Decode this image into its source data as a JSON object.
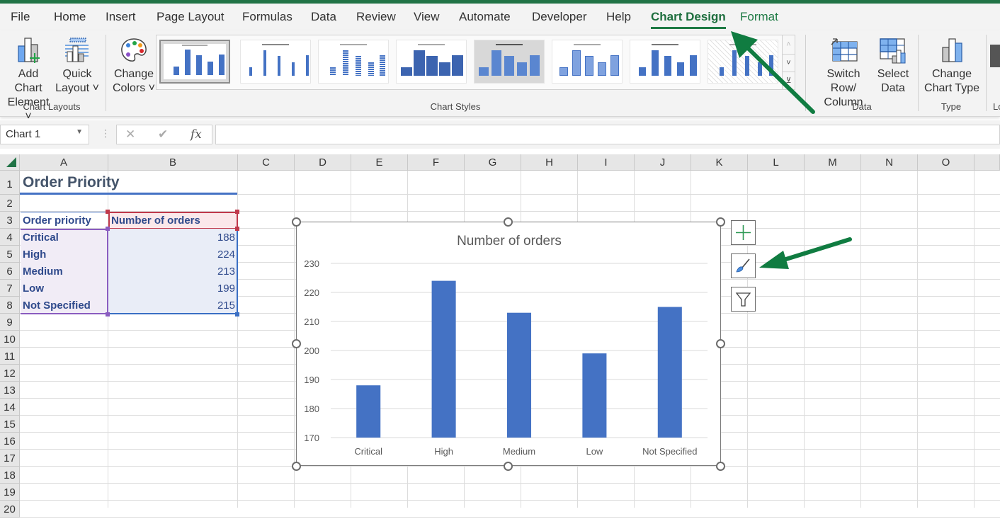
{
  "ribbon_tabs": [
    {
      "label": "File"
    },
    {
      "label": "Home"
    },
    {
      "label": "Insert"
    },
    {
      "label": "Page Layout"
    },
    {
      "label": "Formulas"
    },
    {
      "label": "Data"
    },
    {
      "label": "Review"
    },
    {
      "label": "View"
    },
    {
      "label": "Automate"
    },
    {
      "label": "Developer"
    },
    {
      "label": "Help"
    },
    {
      "label": "Chart Design",
      "active": true
    },
    {
      "label": "Format"
    }
  ],
  "ribbon": {
    "add_chart_element": {
      "line1": "Add Chart",
      "line2": "Element ˅"
    },
    "quick_layout": {
      "line1": "Quick",
      "line2": "Layout ˅"
    },
    "change_colors": {
      "line1": "Change",
      "line2": "Colors ˅"
    },
    "switch_row_column": {
      "line1": "Switch Row/",
      "line2": "Column"
    },
    "select_data": {
      "line1": "Select",
      "line2": "Data"
    },
    "change_chart_type": {
      "line1": "Change",
      "line2": "Chart Type"
    },
    "groups": {
      "chart_layouts": "Chart Layouts",
      "chart_styles": "Chart Styles",
      "data": "Data",
      "type": "Type",
      "location_partial": "Lo"
    },
    "gallery_scroll": {
      "up": "˄",
      "down": "˅",
      "more": "⊻"
    }
  },
  "formula_bar": {
    "name_box": "Chart 1",
    "cancel": "✕",
    "enter": "✔",
    "fx": "fx",
    "formula": ""
  },
  "columns": [
    "A",
    "B",
    "C",
    "D",
    "E",
    "F",
    "G",
    "H",
    "I",
    "J",
    "K",
    "L",
    "M",
    "N",
    "O"
  ],
  "rows": [
    "1",
    "2",
    "3",
    "4",
    "5",
    "6",
    "7",
    "8",
    "9",
    "10",
    "11",
    "12",
    "13",
    "14",
    "15",
    "16",
    "17",
    "18",
    "19",
    "20"
  ],
  "sheet": {
    "title": "Order Priority",
    "table": {
      "header": [
        "Order priority",
        "Number of orders"
      ],
      "rows": [
        [
          "Critical",
          "188"
        ],
        [
          "High",
          "224"
        ],
        [
          "Medium",
          "213"
        ],
        [
          "Low",
          "199"
        ],
        [
          "Not Specified",
          "215"
        ]
      ]
    }
  },
  "chart_side_buttons": [
    {
      "name": "chart-elements-button",
      "icon": "plus-icon"
    },
    {
      "name": "chart-styles-button",
      "icon": "paintbrush-icon"
    },
    {
      "name": "chart-filters-button",
      "icon": "filter-icon"
    }
  ],
  "colors": {
    "excel_green": "#217346",
    "bar_blue": "#4472c4",
    "annotation_arrow": "#107c41"
  },
  "chart_data": {
    "type": "bar",
    "title": "Number of orders",
    "categories": [
      "Critical",
      "High",
      "Medium",
      "Low",
      "Not Specified"
    ],
    "values": [
      188,
      224,
      213,
      199,
      215
    ],
    "xlabel": "",
    "ylabel": "",
    "ylim": [
      170,
      230
    ],
    "yticks": [
      "170",
      "180",
      "190",
      "200",
      "210",
      "220",
      "230"
    ],
    "grid": true,
    "legend": "none"
  }
}
